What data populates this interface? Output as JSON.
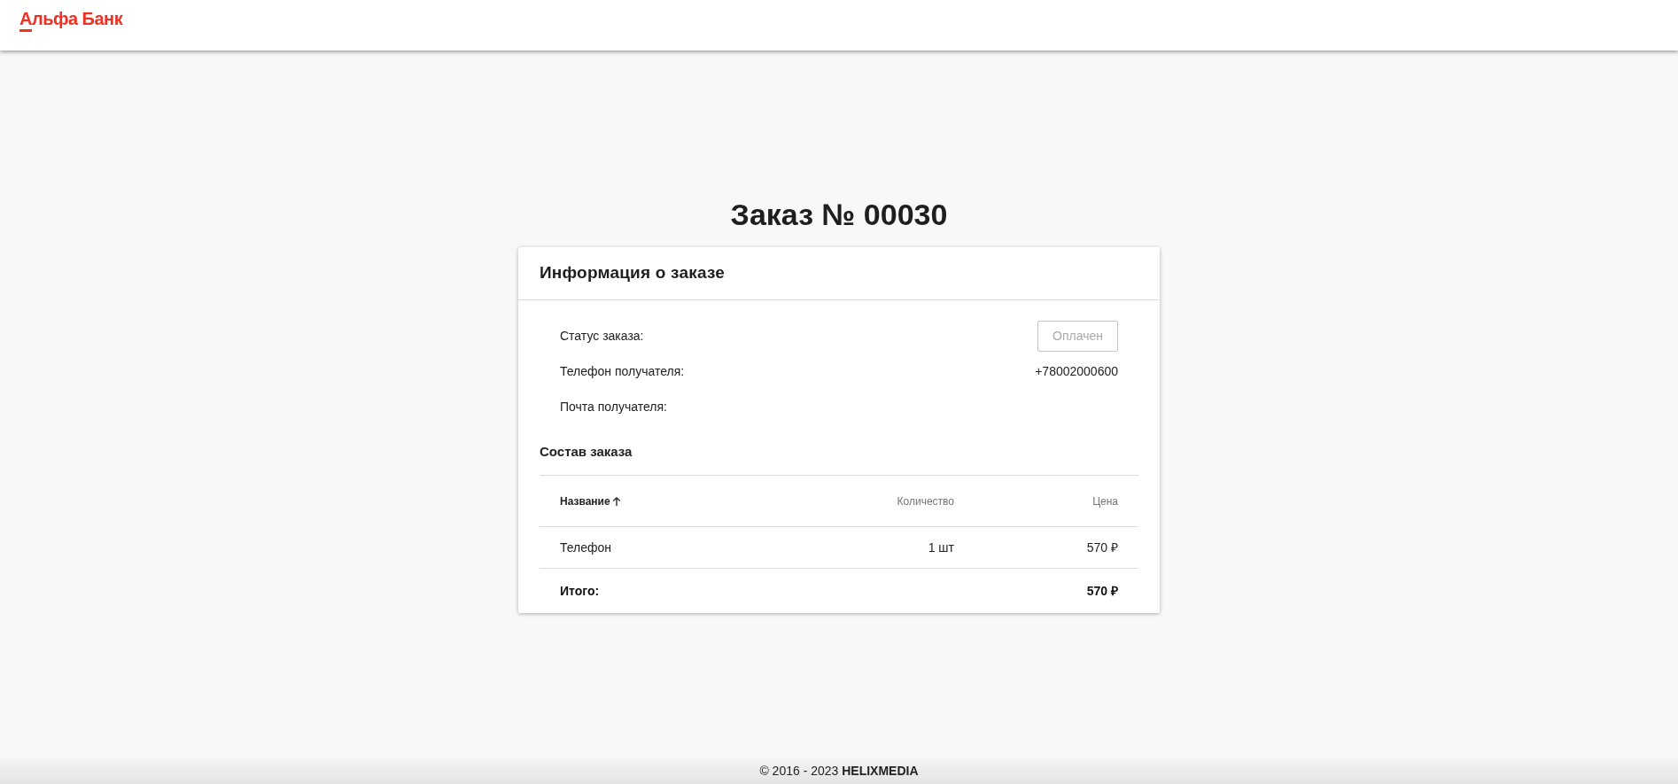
{
  "header": {
    "logo_text": "Альфа Банк"
  },
  "title": "Заказ № 00030",
  "card": {
    "title": "Информация о заказе",
    "details": [
      {
        "kind": "status",
        "label": "Статус заказа:",
        "value": "Оплачен",
        "disabled": true
      },
      {
        "kind": "text",
        "label": "Телефон получателя:",
        "value": "+78002000600"
      },
      {
        "kind": "text",
        "label": "Почта получателя:"
      }
    ],
    "composition": {
      "title": "Состав заказа",
      "table": {
        "columns": [
          {
            "label": "Название",
            "sorted": true
          },
          {
            "label": "Количество",
            "sorted": false
          },
          {
            "label": "Цена",
            "sorted": false
          }
        ],
        "rows": [
          [
            "Телефон",
            "1 шт",
            "570 ₽"
          ]
        ],
        "total": {
          "label": "Итого:",
          "value": "570 ₽"
        }
      }
    }
  },
  "footer": {
    "text": "© 2016 - 2023 **HELIXMEDIA**"
  }
}
